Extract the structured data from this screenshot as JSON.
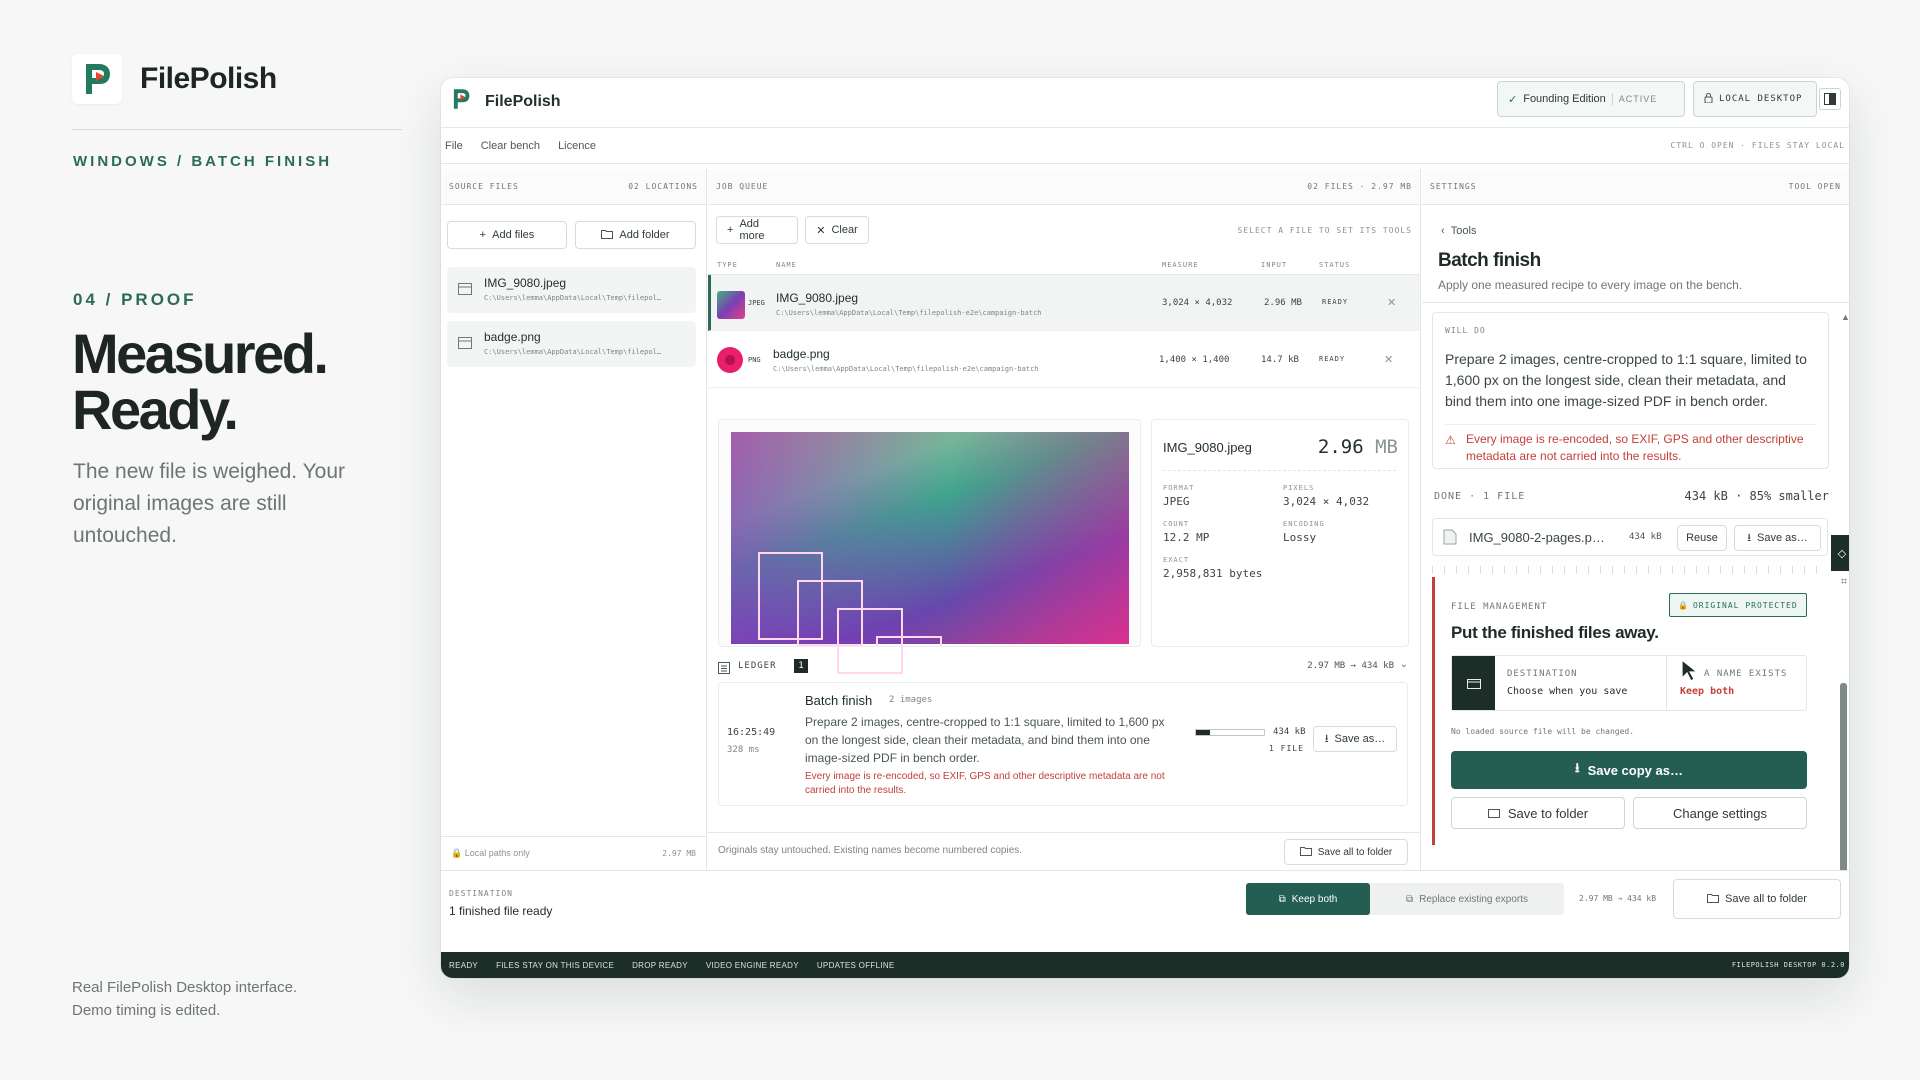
{
  "marketing": {
    "brand_name": "FilePolish",
    "eyebrow": "WINDOWS / BATCH FINISH",
    "step": "04 / PROOF",
    "headline_1": "Measured.",
    "headline_2": "Ready.",
    "lede": "The new file is weighed. Your original images are still untouched.",
    "footnote_1": "Real FilePolish Desktop interface.",
    "footnote_2": "Demo timing is edited."
  },
  "app": {
    "title": "FilePolish",
    "edition": "Founding Edition",
    "edition_state": "ACTIVE",
    "mode": "LOCAL DESKTOP",
    "menu": [
      "File",
      "Clear bench",
      "Licence"
    ],
    "menu_hint": "CTRL O OPEN · FILES STAY LOCAL"
  },
  "source": {
    "title": "SOURCE FILES",
    "count": "02 LOCATIONS",
    "add_files": "Add files",
    "add_folder": "Add folder",
    "files": [
      {
        "name": "IMG_9080.jpeg",
        "path": "C:\\Users\\lemma\\AppData\\Local\\Temp\\filepol…"
      },
      {
        "name": "badge.png",
        "path": "C:\\Users\\lemma\\AppData\\Local\\Temp\\filepol…"
      }
    ],
    "footer_left": "Local paths only",
    "footer_right": "2.97 MB"
  },
  "queue": {
    "title": "JOB QUEUE",
    "summary": "02 FILES · 2.97 MB",
    "add_more": "Add more",
    "clear": "Clear",
    "hint": "SELECT A FILE TO SET ITS TOOLS",
    "cols": {
      "type": "TYPE",
      "name": "NAME",
      "measure": "MEASURE",
      "input": "INPUT",
      "status": "STATUS"
    },
    "rows": [
      {
        "type": "JPEG",
        "name": "IMG_9080.jpeg",
        "path": "C:\\Users\\lemma\\AppData\\Local\\Temp\\filepolish-e2e\\campaign-batch",
        "measure": "3,024 × 4,032",
        "input": "2.96 MB",
        "status": "READY"
      },
      {
        "type": "PNG",
        "name": "badge.png",
        "path": "C:\\Users\\lemma\\AppData\\Local\\Temp\\filepolish-e2e\\campaign-batch",
        "measure": "1,400 × 1,400",
        "input": "14.7 kB",
        "status": "READY"
      }
    ],
    "preview": {
      "name": "IMG_9080.jpeg",
      "size": "2.96",
      "size_unit": "MB",
      "format_label": "FORMAT",
      "format": "JPEG",
      "pixels_label": "PIXELS",
      "pixels": "3,024 × 4,032",
      "count_label": "COUNT",
      "count": "12.2 MP",
      "encoding_label": "ENCODING",
      "encoding": "Lossy",
      "exact_label": "EXACT",
      "exact": "2,958,831 bytes"
    },
    "ledger": {
      "title": "LEDGER",
      "badge": "1",
      "summary": "2.97 MB → 434 kB",
      "time": "16:25:49",
      "duration": "328 ms",
      "job": "Batch finish",
      "job_count": "2 images",
      "description": "Prepare 2 images, centre-cropped to 1:1 square, limited to 1,600 px on the longest side, clean their metadata, and bind them into one image-sized PDF in bench order.",
      "warning": "Every image is re-encoded, so EXIF, GPS and other descriptive metadata are not carried into the results.",
      "out_size": "434 kB",
      "out_count": "1 FILE",
      "save_as": "Save as…",
      "progress": 0.2
    },
    "footer_note": "Originals stay untouched. Existing names become numbered copies.",
    "save_all": "Save all to folder"
  },
  "settings": {
    "title": "SETTINGS",
    "state": "TOOL OPEN",
    "back": "Tools",
    "heading": "Batch finish",
    "subheading": "Apply one measured recipe to every image on the bench.",
    "will_do_label": "WILL DO",
    "will_do": "Prepare 2 images, centre-cropped to 1:1 square, limited to 1,600 px on the longest side, clean their metadata, and bind them into one image-sized PDF in bench order.",
    "warning": "Every image is re-encoded, so EXIF, GPS and other descriptive metadata are not carried into the results.",
    "done_label": "DONE · 1 FILE",
    "done_summary": "434 kB · 85% smaller",
    "result": {
      "name": "IMG_9080-2-pages.p…",
      "size": "434 kB",
      "reuse": "Reuse",
      "save_as": "Save as…"
    },
    "fm": {
      "label": "FILE MANAGEMENT",
      "protected": "ORIGINAL PROTECTED",
      "heading": "Put the finished files away.",
      "dest_label": "DESTINATION",
      "dest_value": "Choose when you save",
      "exists_label": "A NAME EXISTS",
      "exists_value": "Keep both",
      "note": "No loaded source file will be changed.",
      "save_copy": "Save copy as…",
      "save_folder": "Save to folder",
      "change": "Change settings"
    }
  },
  "bottom": {
    "dest_label": "DESTINATION",
    "dest_value": "1 finished file ready",
    "keep_both": "Keep both",
    "replace": "Replace existing exports",
    "summary": "2.97 MB → 434 kB",
    "save_all": "Save all to folder"
  },
  "statusbar": {
    "items": [
      "READY",
      "FILES STAY ON THIS DEVICE",
      "DROP READY",
      "VIDEO ENGINE READY",
      "UPDATES OFFLINE"
    ],
    "version": "FILEPOLISH DESKTOP 0.2.0"
  },
  "colors": {
    "accent": "#245e52",
    "warning": "#c4403a",
    "dark": "#1d2e29"
  }
}
